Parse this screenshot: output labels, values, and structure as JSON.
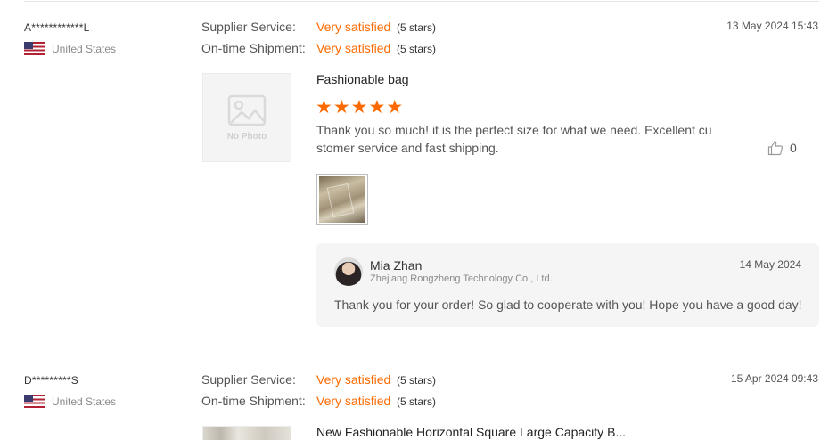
{
  "reviews": [
    {
      "buyer": "A************L",
      "country": "United States",
      "ratings": [
        {
          "label": "Supplier Service:",
          "value": "Very satisfied",
          "stars": "(5 stars)"
        },
        {
          "label": "On-time Shipment:",
          "value": "Very satisfied",
          "stars": "(5 stars)"
        }
      ],
      "date": "13 May 2024 15:43",
      "thumbnail_text": "No Photo",
      "product_title": "Fashionable bag",
      "star_rating": 5,
      "text": "Thank you so much! it is the perfect size for what we need. Excellent customer service and fast shipping.",
      "likes": "0",
      "reply": {
        "name": "Mia Zhan",
        "company": "Zhejiang Rongzheng Technology Co., Ltd.",
        "date": "14 May 2024",
        "text": "Thank you for your order! So glad to cooperate with you! Hope you have a good day!"
      }
    },
    {
      "buyer": "D*********S",
      "country": "United States",
      "ratings": [
        {
          "label": "Supplier Service:",
          "value": "Very satisfied",
          "stars": "(5 stars)"
        },
        {
          "label": "On-time Shipment:",
          "value": "Very satisfied",
          "stars": "(5 stars)"
        }
      ],
      "date": "15 Apr 2024 09:43",
      "product_title": "New Fashionable Horizontal Square Large Capacity B..."
    }
  ],
  "colors": {
    "accent": "#ff6a00",
    "divider": "#e5e5e5",
    "reply_bg": "#f5f5f5"
  },
  "icons": [
    "us-flag-icon",
    "no-photo-icon",
    "star-icon",
    "thumbs-up-icon",
    "seller-avatar"
  ]
}
